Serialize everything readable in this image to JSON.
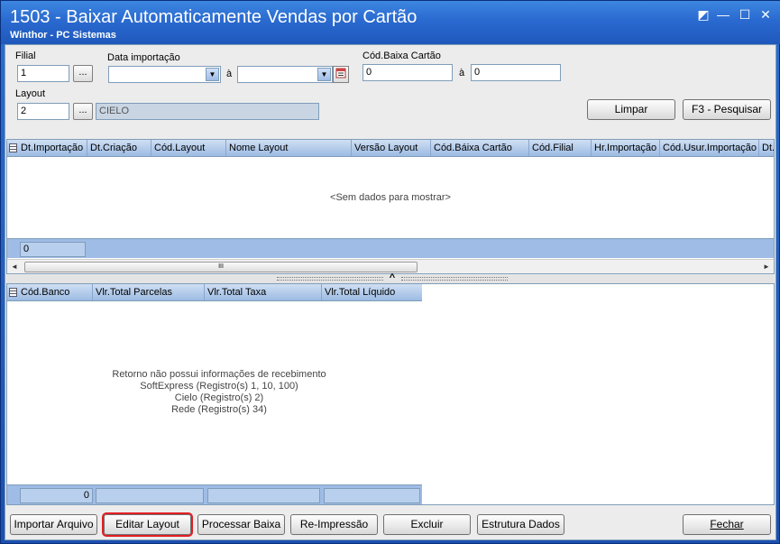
{
  "window": {
    "title": "1503 - Baixar Automaticamente Vendas por Cartão",
    "subtitle": "Winthor - PC Sistemas",
    "controls": {
      "restore": "◩",
      "minimize": "—",
      "maximize": "☐",
      "close": "✕"
    }
  },
  "filters": {
    "filial_label": "Filial",
    "filial_value": "1",
    "dots": "...",
    "data_importacao_label": "Data importação",
    "date_from": "",
    "a_label": "à",
    "date_to": "",
    "cod_baixa_label": "Cód.Baixa Cartão",
    "cod_baixa_from": "0",
    "cod_baixa_to": "0",
    "layout_label": "Layout",
    "layout_value": "2",
    "layout_name": "CIELO",
    "calendar_icon": "calendar-icon",
    "dropdown_icon": "▼"
  },
  "actions": {
    "limpar": "Limpar",
    "pesquisar": "F3 - Pesquisar"
  },
  "grid1": {
    "columns": [
      "Dt.Importação",
      "Dt.Criação",
      "Cód.Layout",
      "Nome Layout",
      "Versão Layout",
      "Cód.Báixa Cartão",
      "Cód.Filial",
      "Hr.Importação",
      "Cód.Usur.Importação",
      "Dt.I"
    ],
    "empty_text": "<Sem dados para mostrar>",
    "footer_count": "0",
    "scroll_thumb": "III",
    "scroll_left": "◄",
    "scroll_right": "►"
  },
  "splitter": {
    "grip": "^"
  },
  "grid2": {
    "columns": [
      "Cód.Banco",
      "Vlr.Total Parcelas",
      "Vlr.Total Taxa",
      "Vlr.Total Líquido"
    ],
    "message": [
      "Retorno não possui informações de recebimento",
      "SoftExpress (Registro(s) 1, 10, 100)",
      "Cielo (Registro(s) 2)",
      "Rede (Registro(s) 34)"
    ],
    "footer_values": [
      "0",
      "",
      "",
      ""
    ]
  },
  "bottom_buttons": {
    "importar": "Importar Arquivo",
    "editar": "Editar Layout",
    "processar": "Processar Baixa",
    "reimpressao": "Re-Impressão",
    "excluir": "Excluir",
    "estrutura": "Estrutura Dados",
    "fechar": "Fechar"
  },
  "colors": {
    "title_bar": "#2a6ad0",
    "grid_header": "#9cbbe3",
    "highlight": "#e31e24"
  }
}
